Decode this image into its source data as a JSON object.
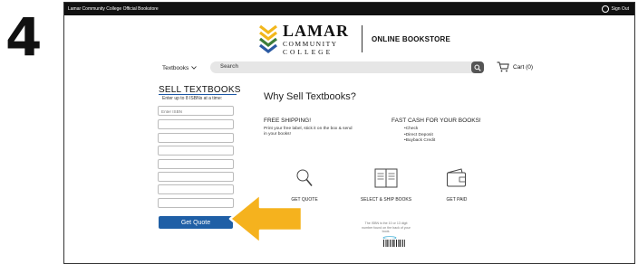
{
  "step_number": "4",
  "topbar": {
    "site_name": "Lamar Community College Official Bookstore",
    "signout_label": "Sign Out"
  },
  "logo": {
    "line1": "LAMAR",
    "line2": "COMMUNITY",
    "line3": "COLLEGE",
    "store": "ONLINE BOOKSTORE"
  },
  "nav": {
    "textbooks_label": "Textbooks",
    "search_placeholder": "Search",
    "cart_label": "Cart (0)"
  },
  "sell": {
    "title": "SELL TEXTBOOKS",
    "subtitle": "Enter up to 8 ISBNs at a time:",
    "first_placeholder": "Enter ISBN",
    "button_label": "Get Quote"
  },
  "why": {
    "heading": "Why Sell Textbooks?",
    "free_shipping_title": "FREE SHIPPING!",
    "free_shipping_desc": "Print your free label, stick it on the box & send in your books!",
    "fast_cash_title": "FAST CASH FOR YOUR BOOKS!",
    "fast_cash_items": [
      "Check",
      "Direct Deposit",
      "Buyback Credit"
    ]
  },
  "steps": [
    {
      "label": "GET QUOTE",
      "icon": "magnifier-icon"
    },
    {
      "label": "SELECT & SHIP BOOKS",
      "icon": "book-icon"
    },
    {
      "label": "GET PAID",
      "icon": "wallet-icon"
    }
  ],
  "isbn_note": "The ISBN is the 10 or 13 digit number found on the back of your book.",
  "colors": {
    "brand_blue": "#1f5fa6",
    "arrow_orange": "#f5b21e",
    "logo_yellow": "#f2b71c",
    "logo_green": "#3d7d3a",
    "logo_blue": "#2b5aa3"
  }
}
